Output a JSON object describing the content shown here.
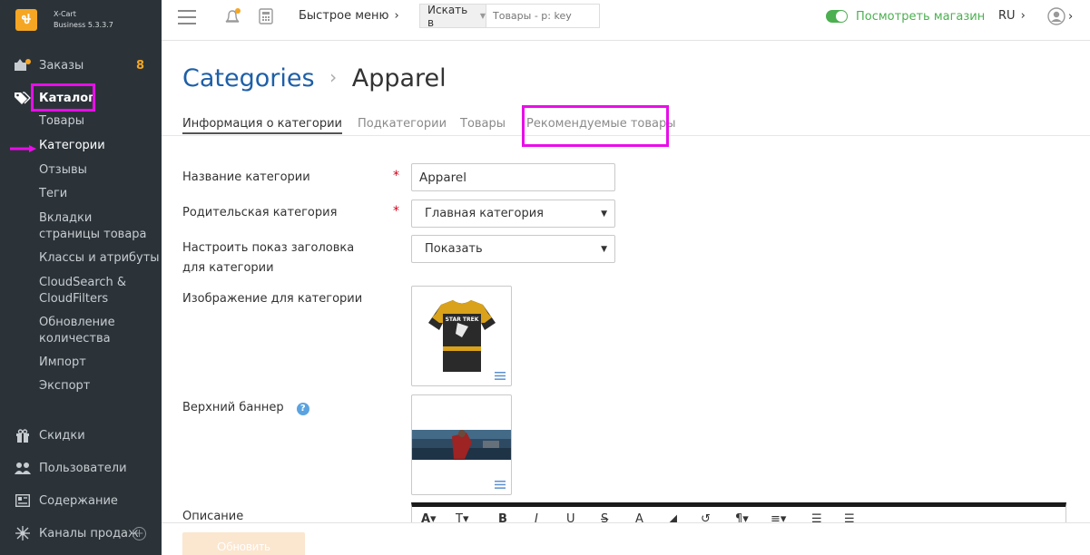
{
  "brand": {
    "name": "X-Cart",
    "edition": "Business 5.3.3.7"
  },
  "sidebar": {
    "orders": {
      "label": "Заказы",
      "count": "8"
    },
    "catalog": {
      "label": "Каталог",
      "items": [
        {
          "label": "Товары"
        },
        {
          "label": "Категории"
        },
        {
          "label": "Отзывы"
        },
        {
          "label": "Теги"
        },
        {
          "label": "Вкладки страницы товара"
        },
        {
          "label": "Классы и атрибуты"
        },
        {
          "label": "CloudSearch & CloudFilters"
        },
        {
          "label": "Обновление количества"
        },
        {
          "label": "Импорт"
        },
        {
          "label": "Экспорт"
        }
      ]
    },
    "discounts": {
      "label": "Скидки"
    },
    "users": {
      "label": "Пользователи"
    },
    "content": {
      "label": "Содержание"
    },
    "channels": {
      "label": "Каналы продаж"
    }
  },
  "topbar": {
    "quick_menu": "Быстрое меню",
    "search_scope": "Искать в",
    "search_placeholder": "Товары - p: key",
    "view_store": "Посмотреть магазин",
    "lang": "RU"
  },
  "breadcrumb": {
    "root": "Categories",
    "current": "Apparel"
  },
  "tabs": [
    {
      "label": "Информация о категории"
    },
    {
      "label": "Подкатегории"
    },
    {
      "label": "Товары"
    },
    {
      "label": "Рекомендуемые товары"
    }
  ],
  "form": {
    "name_label": "Название категории",
    "name_value": "Apparel",
    "parent_label": "Родительская категория",
    "parent_value": "Главная категория",
    "show_title_label": "Настроить показ заголовка для категории",
    "show_title_value": "Показать",
    "image_label": "Изображение для категории",
    "banner_label": "Верхний баннер",
    "description_label": "Описание"
  },
  "footer": {
    "update_label": "Обновить"
  },
  "colors": {
    "sidebar_bg": "#2b3339",
    "accent": "#f5a623",
    "link_blue": "#1e5fa8",
    "highlight": "#e80ee8",
    "store_green": "#4caf50"
  }
}
